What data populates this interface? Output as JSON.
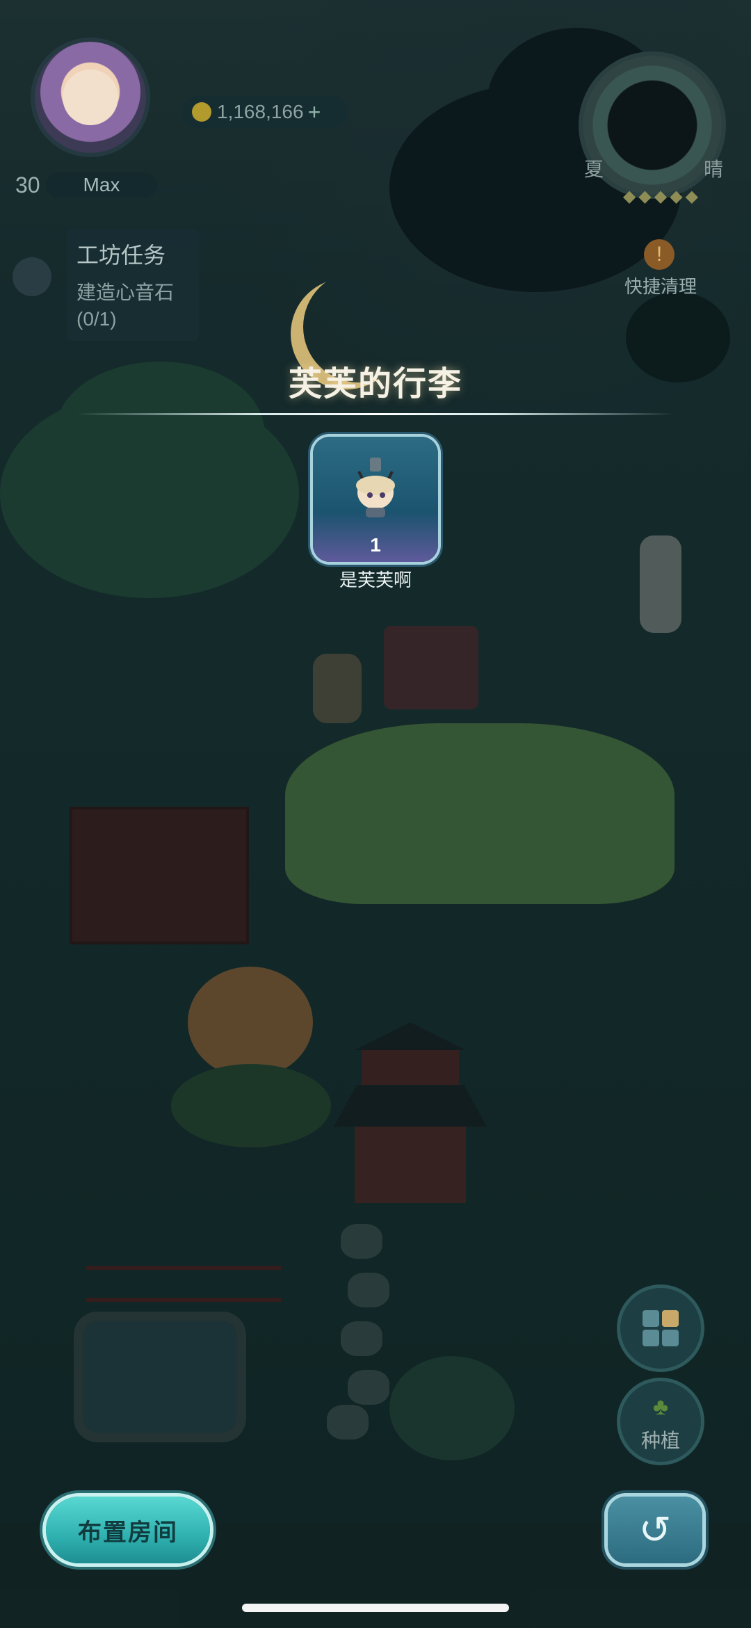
{
  "hud": {
    "level": "30",
    "player_name": "Max",
    "coins": "1,168,166",
    "coin_plus": "+",
    "task_title": "工坊任务",
    "task_desc": "建造心音石\n(0/1)",
    "season": "夏",
    "weather": "晴",
    "stars": "◆◆◆◆◆",
    "quick_clean_icon": "!",
    "quick_clean_label": "快捷清理"
  },
  "modal": {
    "title": "芙芙的行李",
    "item": {
      "count": "1",
      "name": "是芙芙啊"
    }
  },
  "bottom": {
    "arrange_label": "布置房间",
    "back_icon": "↺",
    "plant_icon": "♣",
    "plant_label": "种植"
  },
  "colors": {
    "accent_teal": "#2fb1b0",
    "card_blue": "#1c5470",
    "title_text": "#f5f1e4"
  }
}
